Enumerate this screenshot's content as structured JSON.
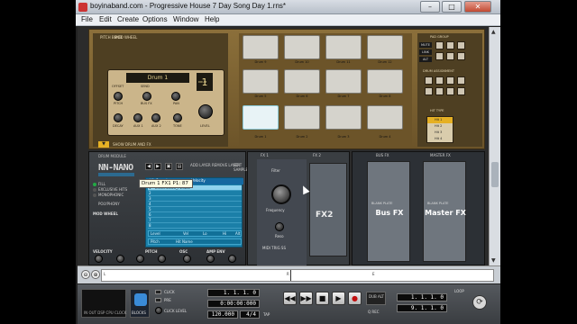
{
  "window": {
    "title": "boyinaband.com - Progressive House 7 Day Song Day 1.rns*",
    "min_label": "–",
    "max_label": "□",
    "close_label": "✕"
  },
  "menu": [
    "File",
    "Edit",
    "Create",
    "Options",
    "Window",
    "Help"
  ],
  "kong": {
    "pitch_bend_label": "PITCH BEND",
    "mod_wheel_label": "MOD WHEEL",
    "drum_name": "Drum 1",
    "drum_number": "1",
    "drum_number_label": "DRUM",
    "offset_label": "OFFSET",
    "send_label": "SEND",
    "pitch_label": "PITCH",
    "bus_fx_label": "BUS FX",
    "pan_label": "PAN",
    "decay_label": "DECAY",
    "aux1_label": "AUX 1",
    "aux2_label": "AUX 2",
    "tone_label": "TONE",
    "level_label": "LEVEL",
    "show_label": "SHOW DRUM AND FX",
    "pads": [
      {
        "label": "Drum 9"
      },
      {
        "label": "Drum 10"
      },
      {
        "label": "Drum 11"
      },
      {
        "label": "Drum 12"
      },
      {
        "label": "Drum 5"
      },
      {
        "label": "Drum 6"
      },
      {
        "label": "Drum 7"
      },
      {
        "label": "Drum 8"
      },
      {
        "label": "Drum 1"
      },
      {
        "label": "Drum 2"
      },
      {
        "label": "Drum 3"
      },
      {
        "label": "Drum 4"
      }
    ],
    "pad_group_label": "PAD GROUP",
    "mute_label": "MUTE",
    "link_label": "LINK",
    "alt_label": "ALT",
    "drum_assign_label": "DRUM ASSIGNMENT",
    "hit_type_label": "HIT TYPE",
    "hit_types": [
      "Hit 1",
      "Hit 2",
      "Hit 3",
      "Hit 4"
    ]
  },
  "drum_module": {
    "section_label": "DRUM MODULE",
    "logo": "NN-NANO",
    "add_layer_label": "ADD LAYER",
    "remove_layer_label": "REMOVE LAYER",
    "edit_sample_label": "EDIT SAMPLE",
    "fill_label": "FILL",
    "exclusive_label": "EXCLUSIVE HITS",
    "monophonic_label": "MONOPHONIC",
    "polyphony_label": "POLYPHONY",
    "mod_wheel_label": "MOD WHEEL",
    "col_hit_sample": "Hit Sample",
    "col_velocity": "Velocity",
    "first_sample": "ElectricKick_PL.wav",
    "rows": [
      "1",
      "2",
      "3",
      "4",
      "5",
      "6",
      "7",
      "8"
    ],
    "level_row": [
      "Level",
      "Vel",
      "Lo",
      "Hi",
      "Alt"
    ],
    "pitch_row": [
      "Pitch",
      "Hit Name"
    ],
    "velocity_label": "VELOCITY",
    "pitch_label": "PITCH",
    "osc_label": "OSC",
    "amp_env_label": "AMP ENV",
    "knob_labels": [
      "PITCH",
      "DECAY",
      "LEVEL",
      "S. START",
      "ATTACK",
      "LEVEL"
    ],
    "bend_label": "BEND"
  },
  "fx_a": {
    "fx1_label": "FX 1",
    "fx2_label": "FX 2",
    "filter_label": "Filter",
    "freq_label": "Frequency",
    "reso_label": "Reso",
    "midi_trig_label": "MIDI TRIG SS",
    "fx2_name": "FX2"
  },
  "tooltip": "Drum 1 FX1 P1: 87",
  "mix_fx": {
    "bus_fx_label": "BUS FX",
    "master_fx_label": "MASTER FX",
    "bus_name": "Bus FX",
    "master_name": "Master FX",
    "blank_plate_label": "BLANK PLATE"
  },
  "transport": {
    "screen_label": "IN OUT DSP CPU CLOCK",
    "blocks_label": "BLOCKS",
    "click_label": "CLICK",
    "pre_label": "PRE",
    "click_level_label": "CLICK LEVEL",
    "position": "1. 1. 1. 0",
    "time": "0:00:00:000",
    "tempo": "120.000",
    "signature": "4/4",
    "tap_label": "TAP",
    "q_rec_label": "Q REC",
    "dub_label": "DUB",
    "alt_label": "ALT",
    "left_locator": "1. 1. 1. 0",
    "right_locator": "9. 1. 1. 0",
    "loop_label": "LOOP",
    "play_label": "▶",
    "stop_label": "■",
    "rewind_label": "◀◀",
    "ffwd_label": "▶▶",
    "record_label": "●"
  },
  "seq": {
    "markers": [
      "L",
      "R",
      "E"
    ]
  },
  "colors": {
    "accent": "#1b7fa8",
    "kong_panel": "#cbb58a",
    "record": "#c21010"
  }
}
